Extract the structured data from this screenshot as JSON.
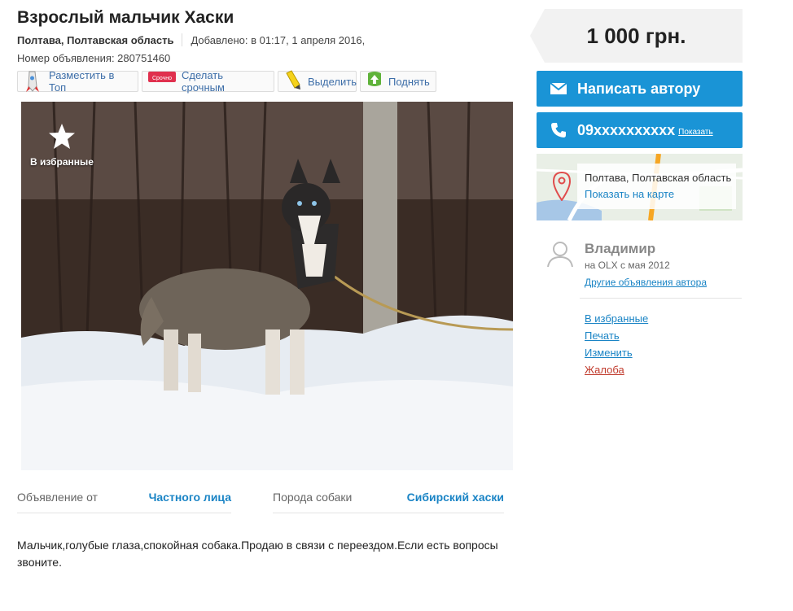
{
  "listing": {
    "title": "Взрослый мальчик Хаски",
    "location": "Полтава, Полтавская область",
    "added": "Добавлено: в 01:17, 1 апреля 2016,",
    "ad_number": "Номер объявления: 280751460"
  },
  "actions": {
    "top": "Разместить в Топ",
    "urgent": "Сделать срочным",
    "urgent_badge": "Срочно",
    "highlight": "Выделить",
    "raise": "Поднять"
  },
  "photo": {
    "favorite_label": "В избранные",
    "icon": "star-icon"
  },
  "params": [
    {
      "key": "Объявление от",
      "value": "Частного лица"
    },
    {
      "key": "Порода собаки",
      "value": "Сибирский хаски"
    }
  ],
  "description": "Мальчик,голубые глаза,спокойная собака.Продаю в связи с переездом.Если есть вопросы звоните.",
  "sidebar": {
    "price": "1 000 грн.",
    "message_button": "Написать автору",
    "phone": "09xxxxxxxxxx",
    "phone_show": "Показать",
    "map_location": "Полтава, Полтавская область",
    "map_link": "Показать на карте",
    "seller_name": "Владимир",
    "seller_since": "на OLX с мая 2012",
    "seller_other": "Другие объявления автора",
    "links": {
      "favorite": "В избранные",
      "print": "Печать",
      "edit": "Изменить",
      "complaint": "Жалоба"
    }
  },
  "colors": {
    "accent": "#1a94d6",
    "link": "#1a84c5",
    "complaint": "#c0392b"
  }
}
